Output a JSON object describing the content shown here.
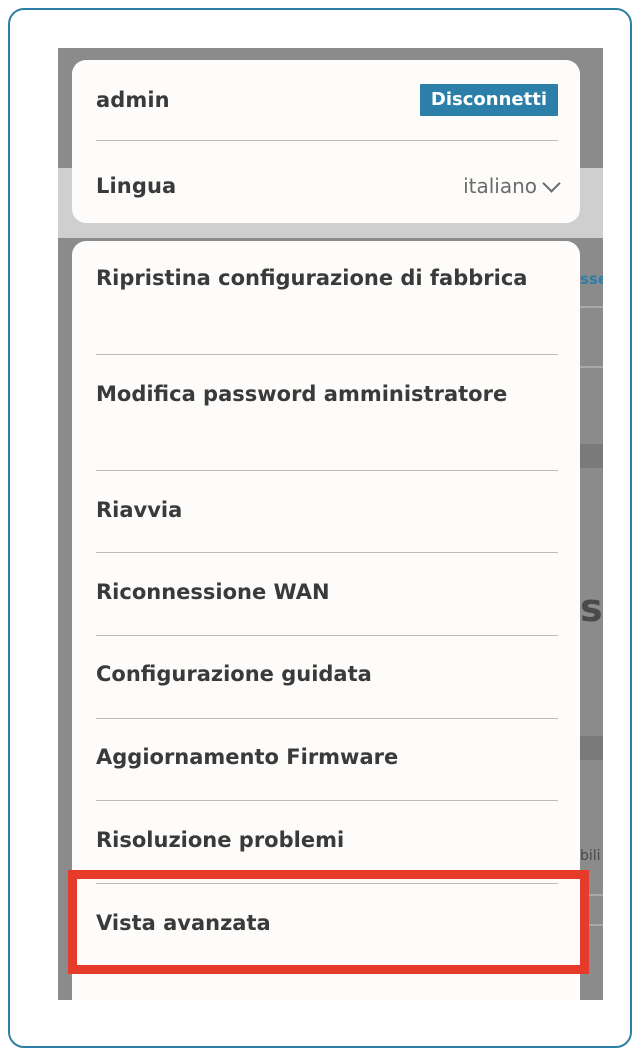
{
  "user": {
    "username": "admin",
    "logout_label": "Disconnetti"
  },
  "language": {
    "label": "Lingua",
    "value": "italiano"
  },
  "menu": {
    "items": [
      {
        "label": "Ripristina configurazione di fabbrica"
      },
      {
        "label": "Modifica password amministratore"
      },
      {
        "label": "Riavvia"
      },
      {
        "label": "Riconnessione WAN"
      },
      {
        "label": "Configurazione guidata"
      },
      {
        "label": "Aggiornamento Firmware"
      },
      {
        "label": "Risoluzione problemi"
      },
      {
        "label": "Vista avanzata"
      }
    ]
  },
  "background": {
    "fragment_1": "sse",
    "fragment_2": "st",
    "fragment_3": "bili"
  },
  "colors": {
    "accent": "#2b7fa8",
    "highlight": "#e63b2a",
    "frame": "#2d7fa3"
  }
}
